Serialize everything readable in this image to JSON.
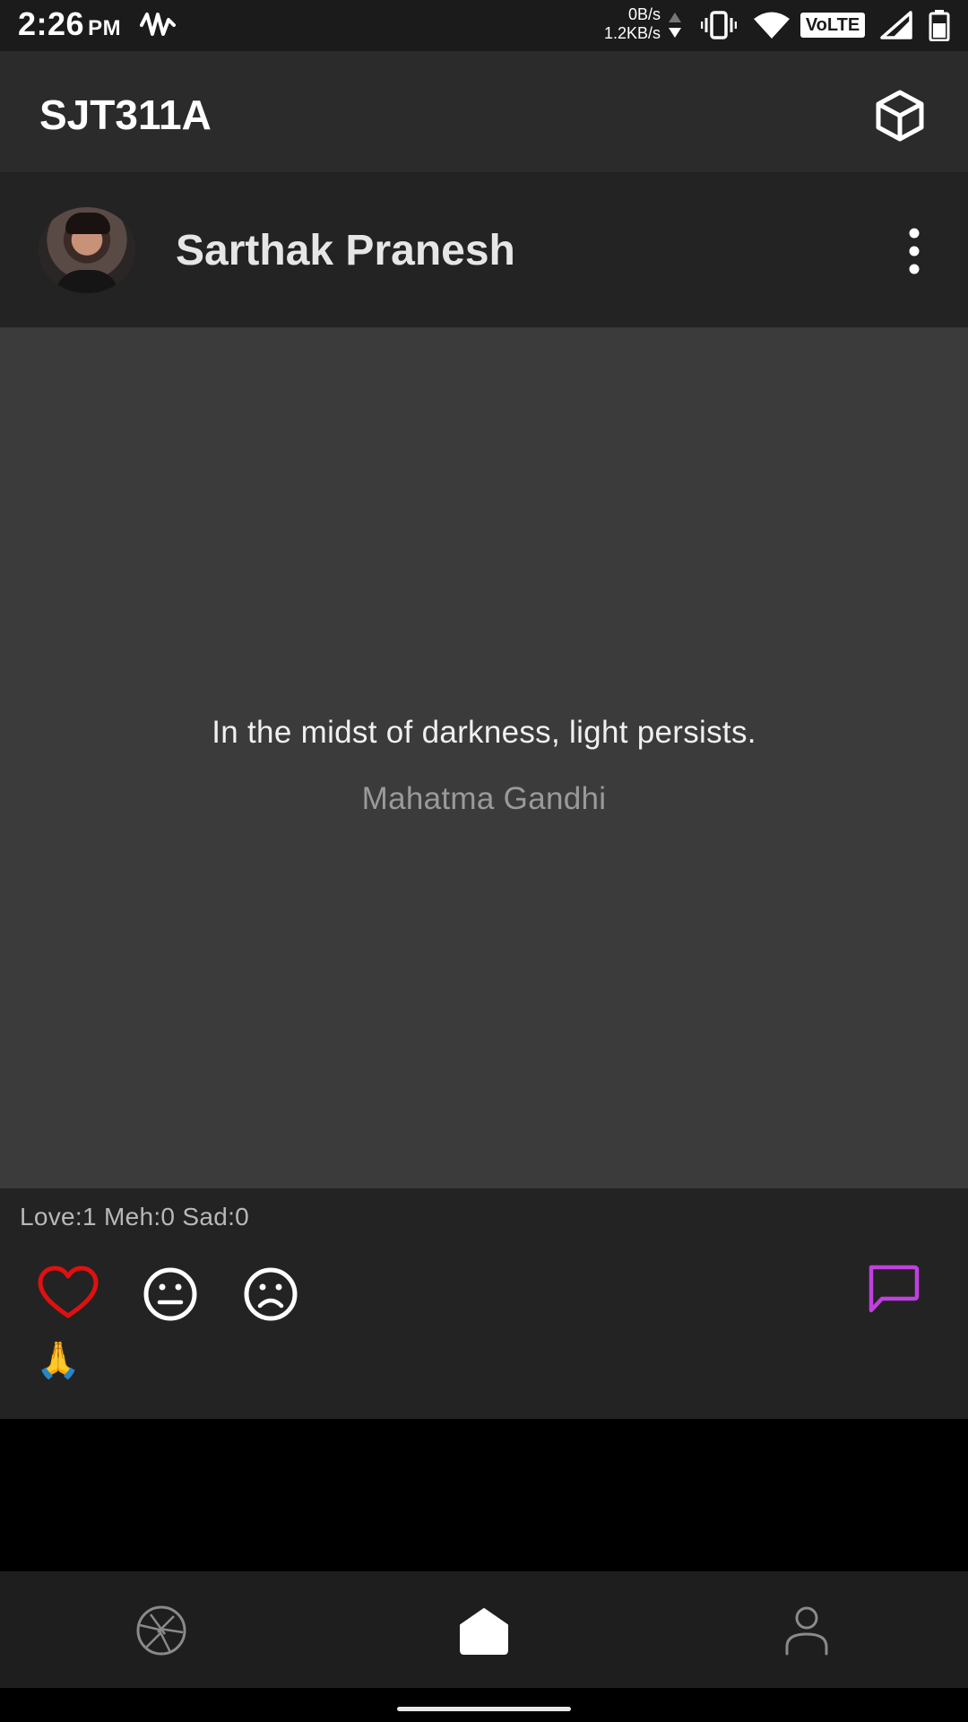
{
  "status_bar": {
    "time": "2:26",
    "ampm": "PM",
    "net_up": "0B/s",
    "net_down": "1.2KB/s",
    "volte": "VoLTE",
    "icons": [
      "activity-icon",
      "vibrate-icon",
      "wifi-icon",
      "signal-icon",
      "battery-icon"
    ]
  },
  "app_bar": {
    "title": "SJT311A",
    "action_icon": "cube-icon"
  },
  "post": {
    "author": "Sarthak Pranesh",
    "quote": "In the midst of darkness, light persists.",
    "quote_author": "Mahatma Gandhi",
    "reaction_counts": "Love:1 Meh:0 Sad:0",
    "reactions": [
      "heart-icon",
      "neutral-face-icon",
      "sad-face-icon"
    ],
    "emoji": "🙏",
    "colors": {
      "love": "#e01010",
      "comment": "#c040e0"
    }
  },
  "bottom_nav": {
    "items": [
      "aperture-icon",
      "home-icon",
      "profile-icon"
    ],
    "active_index": 1
  }
}
